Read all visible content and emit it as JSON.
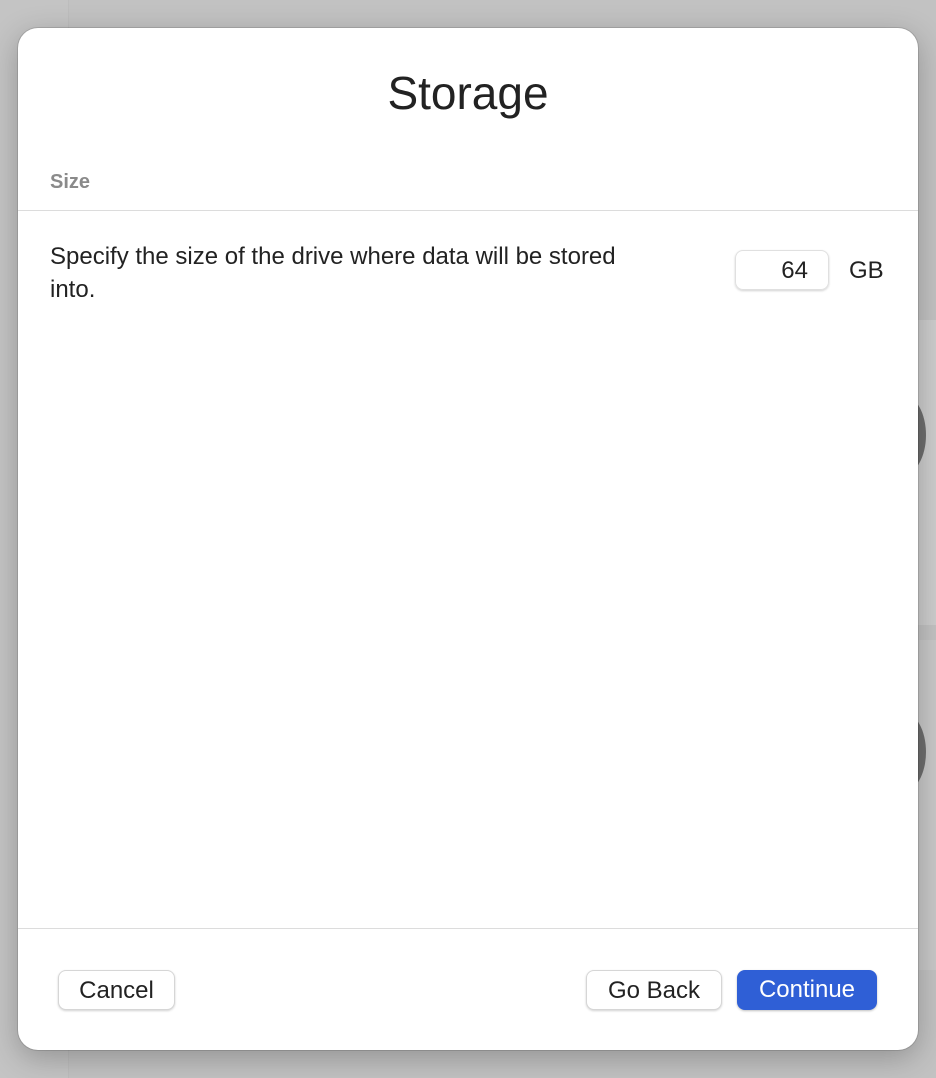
{
  "dialog": {
    "title": "Storage",
    "section_label": "Size",
    "description": "Specify the size of the drive where data will be stored into.",
    "size_value": "64",
    "size_unit": "GB"
  },
  "buttons": {
    "cancel": "Cancel",
    "go_back": "Go Back",
    "continue": "Continue"
  },
  "colors": {
    "accent": "#2f5fd6"
  }
}
